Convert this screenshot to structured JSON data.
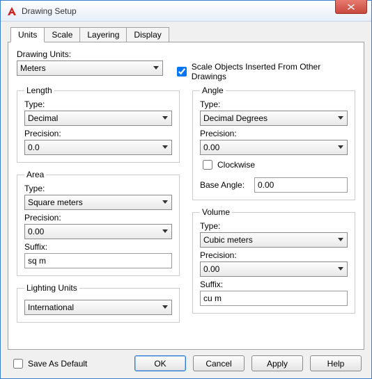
{
  "window": {
    "title": "Drawing Setup"
  },
  "tabs": [
    "Units",
    "Scale",
    "Layering",
    "Display"
  ],
  "labels": {
    "drawing_units": "Drawing Units:",
    "type": "Type:",
    "precision": "Precision:",
    "suffix": "Suffix:",
    "base_angle": "Base Angle:"
  },
  "drawing_units_value": "Meters",
  "scale_objects": {
    "label": "Scale Objects Inserted From Other Drawings",
    "checked": true
  },
  "length": {
    "legend": "Length",
    "type": "Decimal",
    "precision": "0.0"
  },
  "area": {
    "legend": "Area",
    "type": "Square meters",
    "precision": "0.00",
    "suffix": "sq m"
  },
  "lighting": {
    "legend": "Lighting Units",
    "value": "International"
  },
  "angle": {
    "legend": "Angle",
    "type": "Decimal Degrees",
    "precision": "0.00",
    "clockwise_label": "Clockwise",
    "clockwise_checked": false,
    "base_angle": "0.00"
  },
  "volume": {
    "legend": "Volume",
    "type": "Cubic meters",
    "precision": "0.00",
    "suffix": "cu m"
  },
  "save_default": {
    "label": "Save As Default",
    "checked": false
  },
  "buttons": {
    "ok": "OK",
    "cancel": "Cancel",
    "apply": "Apply",
    "help": "Help"
  }
}
